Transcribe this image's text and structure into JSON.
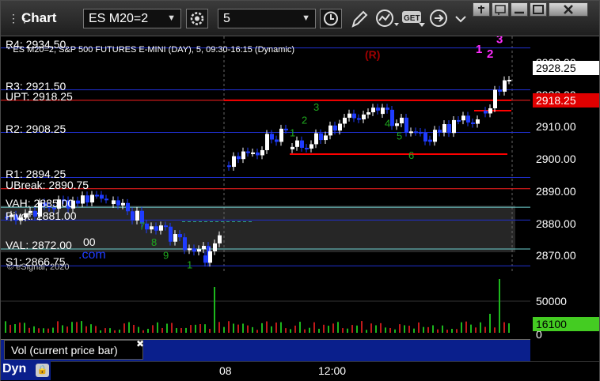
{
  "window": {
    "title": "Chart",
    "symbol": "ES M20=2",
    "interval": "5"
  },
  "study_label": "* ES M20=2, S&P 500 FUTURES E-MINI (DAY), 5, 09:30-16:15 (Dynamic)",
  "r_marker": "(R)",
  "copyright": "© eSignal, 2020",
  "watermark_fragment": ".com",
  "levels": [
    {
      "label": "R4: 2934.50",
      "value": 2934.5
    },
    {
      "label": "R3: 2921.50",
      "value": 2921.5
    },
    {
      "label": "UPT: 2918.25",
      "value": 2918.25
    },
    {
      "label": "R2: 2908.25",
      "value": 2908.25
    },
    {
      "label": "R1: 2894.25",
      "value": 2894.25
    },
    {
      "label": "UBreak: 2890.75",
      "value": 2890.75
    },
    {
      "label": "VAH: 2885.00",
      "value": 2885.0
    },
    {
      "label": "Pivot: 2881.00",
      "value": 2881.0
    },
    {
      "label": "VAL: 2872.00",
      "value": 2872.0
    },
    {
      "label": "S1: 2866.75",
      "value": 2866.75
    }
  ],
  "extra_fragment": "00",
  "price_axis": [
    "2930.00",
    "2920.00",
    "2910.00",
    "2900.00",
    "2890.00",
    "2880.00",
    "2870.00"
  ],
  "last_price": "2928.25",
  "upt_price": "2918.25",
  "volume_axis": [
    "50000",
    "0"
  ],
  "volume_value": "16100",
  "volume_label": "Vol (current price bar)",
  "time_axis": [
    "08",
    "12:00"
  ],
  "bottom_label": "Dyn",
  "colors": {
    "up": "#ffffff",
    "down": "#1f3cff",
    "resistance": "#ff0000",
    "level_line": "#2030d0",
    "volume_green": "#00c000"
  }
}
